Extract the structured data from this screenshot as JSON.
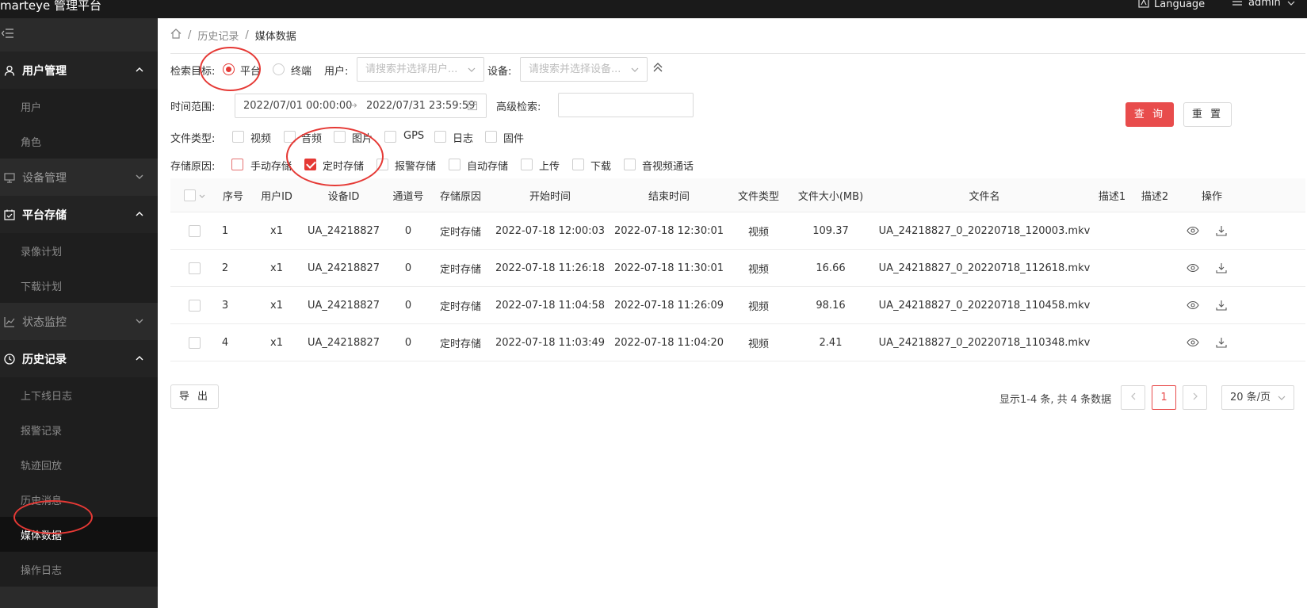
{
  "app": {
    "title": "marteye 管理平台",
    "language_label": "Language",
    "user_label": "admin"
  },
  "sidebar": {
    "groups": [
      {
        "label": "用户管理",
        "open": true,
        "items": [
          "用户",
          "角色"
        ]
      },
      {
        "label": "设备管理",
        "open": false,
        "items": []
      },
      {
        "label": "平台存储",
        "open": true,
        "items": [
          "录像计划",
          "下载计划"
        ]
      },
      {
        "label": "状态监控",
        "open": false,
        "items": []
      },
      {
        "label": "历史记录",
        "open": true,
        "items": [
          "上下线日志",
          "报警记录",
          "轨迹回放",
          "历史消息",
          "媒体数据",
          "操作日志"
        ]
      }
    ],
    "active_item": "媒体数据"
  },
  "breadcrumb": {
    "parent": "历史记录",
    "current": "媒体数据",
    "separator": "/"
  },
  "filters": {
    "target_label": "检索目标:",
    "target_options": [
      "平台",
      "终端"
    ],
    "target_selected": "平台",
    "user_label": "用户:",
    "user_placeholder": "请搜索并选择用户...",
    "device_label": "设备:",
    "device_placeholder": "请搜索并选择设备...",
    "time_label": "时间范围:",
    "time_start": "2022/07/01 00:00:00",
    "time_sep": "→",
    "time_end": "2022/07/31 23:59:59",
    "advanced_label": "高级检索:",
    "advanced_value": "",
    "filetype_label": "文件类型:",
    "filetypes": [
      "视频",
      "音频",
      "图片",
      "GPS",
      "日志",
      "固件"
    ],
    "reason_label": "存储原因:",
    "reasons": [
      "手动存储",
      "定时存储",
      "报警存储",
      "自动存储",
      "上传",
      "下载",
      "音视频通话"
    ],
    "reasons_checked": [
      "定时存储"
    ],
    "query_button": "查 询",
    "reset_button": "重 置"
  },
  "table": {
    "columns": [
      "序号",
      "用户ID",
      "设备ID",
      "通道号",
      "存储原因",
      "开始时间",
      "结束时间",
      "文件类型",
      "文件大小(MB)",
      "文件名",
      "描述1",
      "描述2",
      "操作"
    ],
    "rows": [
      {
        "no": "1",
        "user": "x1",
        "device": "UA_24218827",
        "channel": "0",
        "reason": "定时存储",
        "start": "2022-07-18 12:00:03",
        "end": "2022-07-18 12:30:01",
        "type": "视频",
        "size": "109.37",
        "file": "UA_24218827_0_20220718_120003.mkv",
        "d1": "",
        "d2": ""
      },
      {
        "no": "2",
        "user": "x1",
        "device": "UA_24218827",
        "channel": "0",
        "reason": "定时存储",
        "start": "2022-07-18 11:26:18",
        "end": "2022-07-18 11:30:01",
        "type": "视频",
        "size": "16.66",
        "file": "UA_24218827_0_20220718_112618.mkv",
        "d1": "",
        "d2": ""
      },
      {
        "no": "3",
        "user": "x1",
        "device": "UA_24218827",
        "channel": "0",
        "reason": "定时存储",
        "start": "2022-07-18 11:04:58",
        "end": "2022-07-18 11:26:09",
        "type": "视频",
        "size": "98.16",
        "file": "UA_24218827_0_20220718_110458.mkv",
        "d1": "",
        "d2": ""
      },
      {
        "no": "4",
        "user": "x1",
        "device": "UA_24218827",
        "channel": "0",
        "reason": "定时存储",
        "start": "2022-07-18 11:03:49",
        "end": "2022-07-18 11:04:20",
        "type": "视频",
        "size": "2.41",
        "file": "UA_24218827_0_20220718_110348.mkv",
        "d1": "",
        "d2": ""
      }
    ]
  },
  "footer": {
    "export_button": "导 出",
    "summary": "显示1-4 条, 共 4 条数据",
    "page": "1",
    "page_size": "20 条/页"
  },
  "colors": {
    "accent": "#e84c4c",
    "sidebar_bg": "#2b2b2b",
    "topbar_bg": "#1a1a1a"
  }
}
